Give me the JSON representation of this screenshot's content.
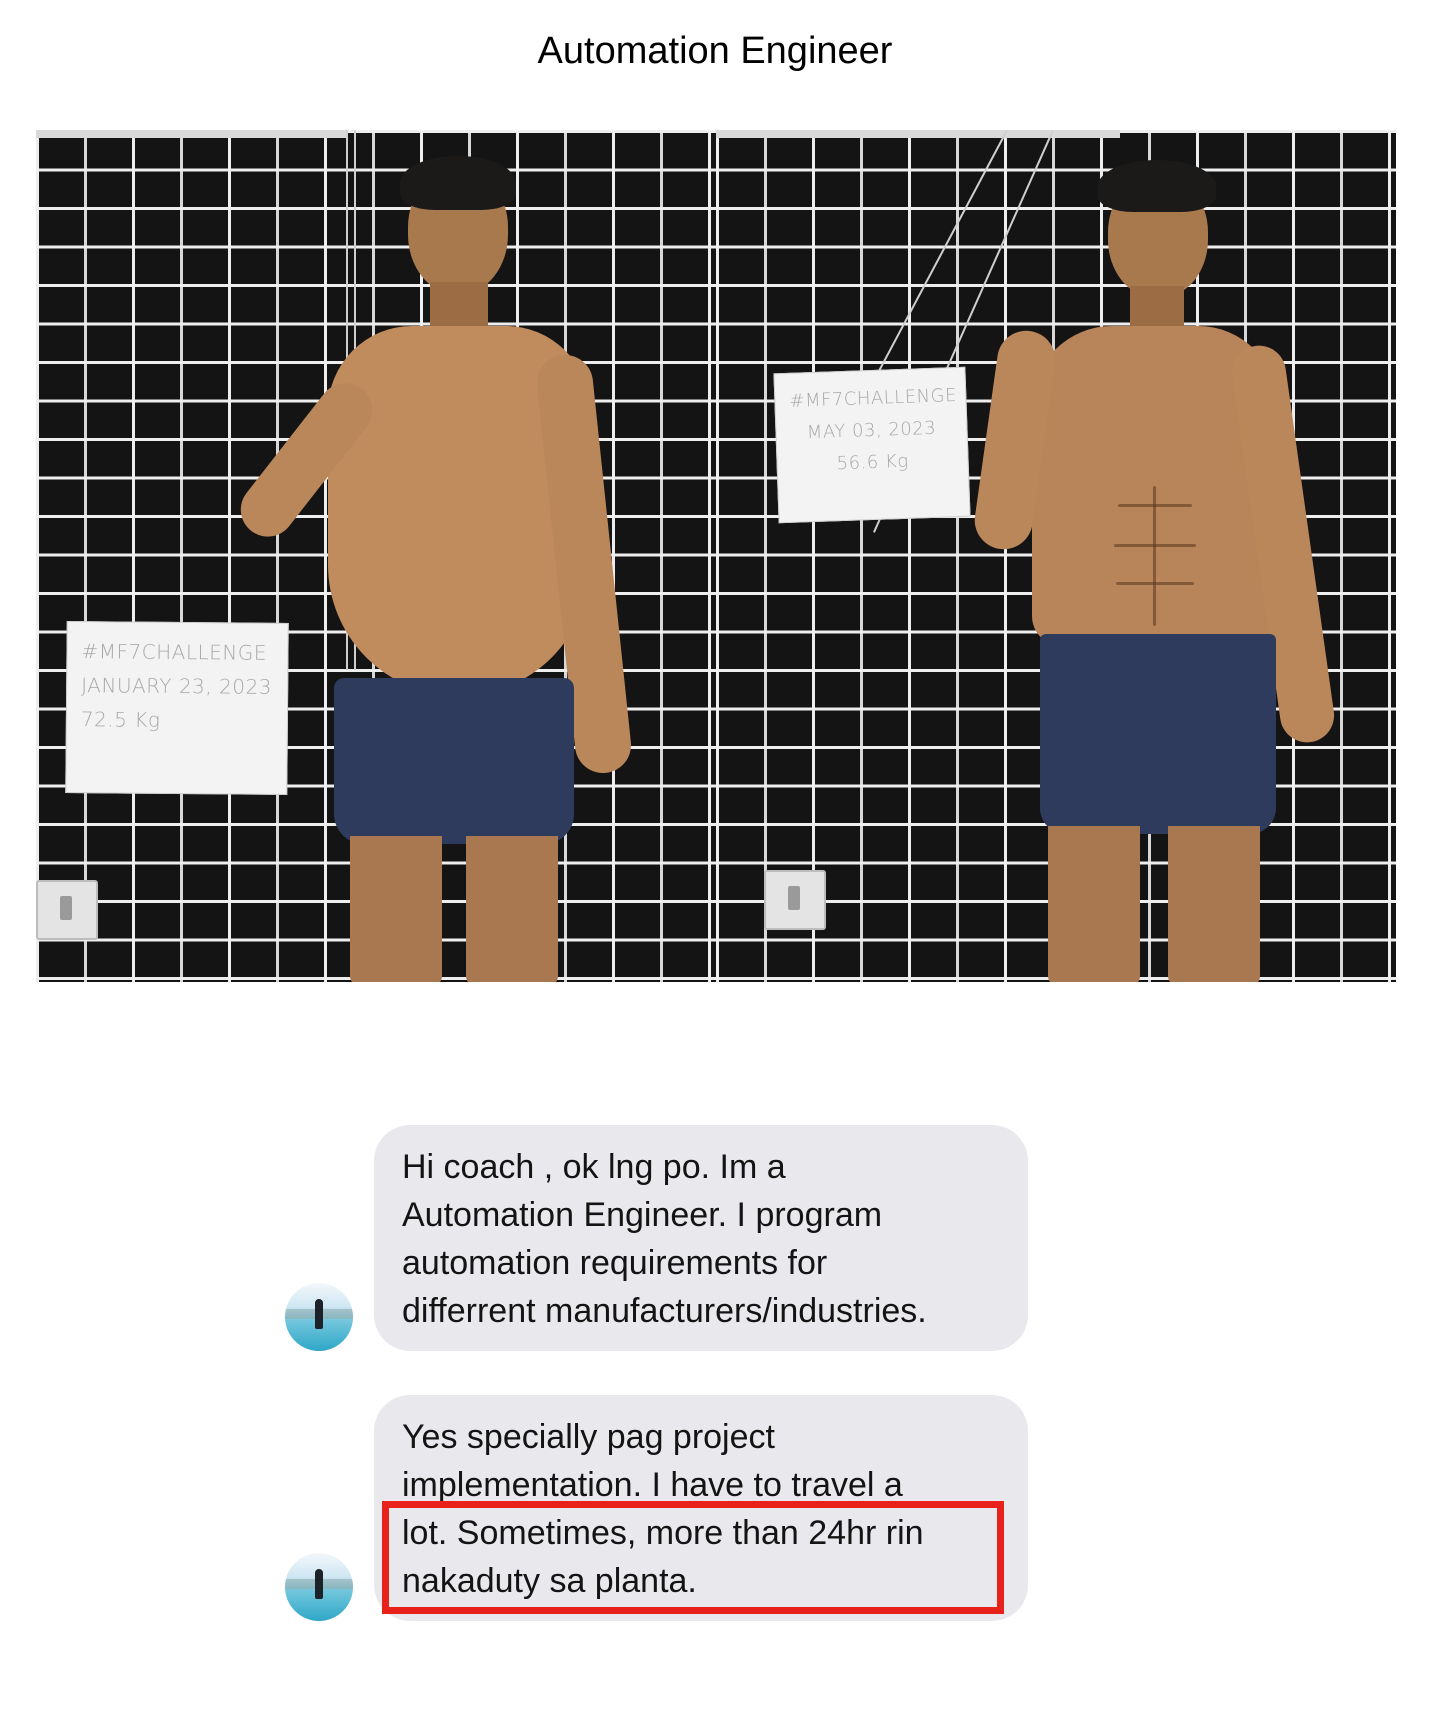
{
  "page": {
    "title": "Automation Engineer"
  },
  "photos": {
    "before": {
      "sign_lines": [
        "#MF7CHALLENGE",
        "JANUARY 23, 2023",
        "72.5 Kg"
      ]
    },
    "after": {
      "sign_lines": [
        "#MF7CHALLENGE",
        "MAY 03, 2023",
        "56.6 Kg"
      ]
    }
  },
  "chat": {
    "messages": [
      {
        "lines": [
          "Hi coach , ok lng po. Im a",
          "Automation Engineer. I program",
          "automation requirements for",
          "differrent manufacturers/industries."
        ]
      },
      {
        "lines": [
          "Yes specially pag project",
          "implementation. I have to travel a",
          "lot. Sometimes, more than 24hr rin",
          "nakaduty sa planta."
        ]
      }
    ]
  },
  "colors": {
    "bubble": "#e9e9ed",
    "highlight": "#e8211b",
    "brick_mortar": "#eeeeee",
    "brick": "#141414"
  }
}
